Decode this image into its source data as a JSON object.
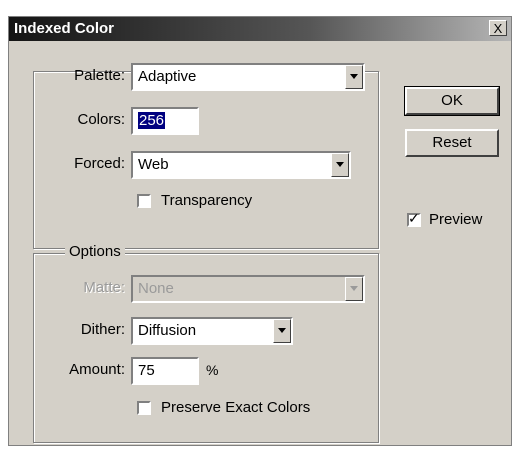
{
  "window": {
    "title": "Indexed Color",
    "close_label": "X"
  },
  "palette_group": {
    "palette_label": "Palette:",
    "palette_value": "Adaptive",
    "colors_label": "Colors:",
    "colors_value": "256",
    "forced_label": "Forced:",
    "forced_value": "Web",
    "transparency_label": "Transparency",
    "transparency_checked": false
  },
  "options_group": {
    "legend": "Options",
    "matte_label": "Matte:",
    "matte_value": "None",
    "dither_label": "Dither:",
    "dither_value": "Diffusion",
    "amount_label": "Amount:",
    "amount_value": "75",
    "amount_unit": "%",
    "preserve_label": "Preserve Exact Colors",
    "preserve_checked": false
  },
  "buttons": {
    "ok_label": "OK",
    "reset_label": "Reset"
  },
  "preview": {
    "label": "Preview",
    "checked": true
  }
}
